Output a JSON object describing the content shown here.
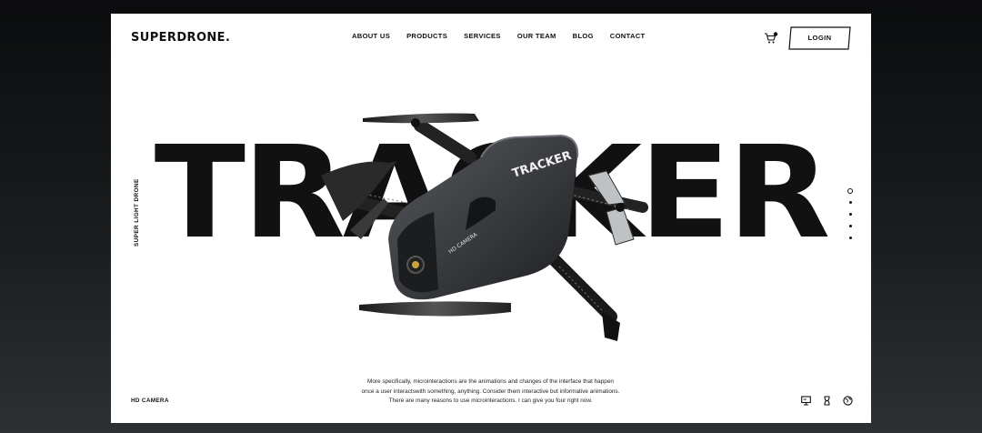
{
  "brand": {
    "logo": "SUPERDRONE."
  },
  "nav": {
    "items": [
      {
        "label": "ABOUT US"
      },
      {
        "label": "PRODUCTS"
      },
      {
        "label": "SERVICES"
      },
      {
        "label": "OUR TEAM"
      },
      {
        "label": "BLOG"
      },
      {
        "label": "CONTACT"
      }
    ]
  },
  "header": {
    "login_label": "LOGIN",
    "cart_icon": "cart-icon"
  },
  "hero": {
    "word": "TRACKER",
    "side_label": "SUPER LIGHT DRONE",
    "drone_text": {
      "model": "TRACKER",
      "camera": "HD CAMERA"
    },
    "slides_total": 5,
    "slide_active": 1
  },
  "footer": {
    "feature_label": "HD CAMERA",
    "description": [
      "More specifically, microinteractions are the animations and changes of the interface that happen",
      "once a user interactswith something, anything. Consider them interactive but informative animations.",
      "There are many reasons to use microinteractions. I can give you four right now."
    ],
    "icons": [
      "monitor-icon",
      "hourglass-icon",
      "globe-icon"
    ]
  },
  "colors": {
    "text": "#111111",
    "page": "#ffffff",
    "backdrop": "#1a1d1f",
    "drone_body": "#3a3c40"
  }
}
